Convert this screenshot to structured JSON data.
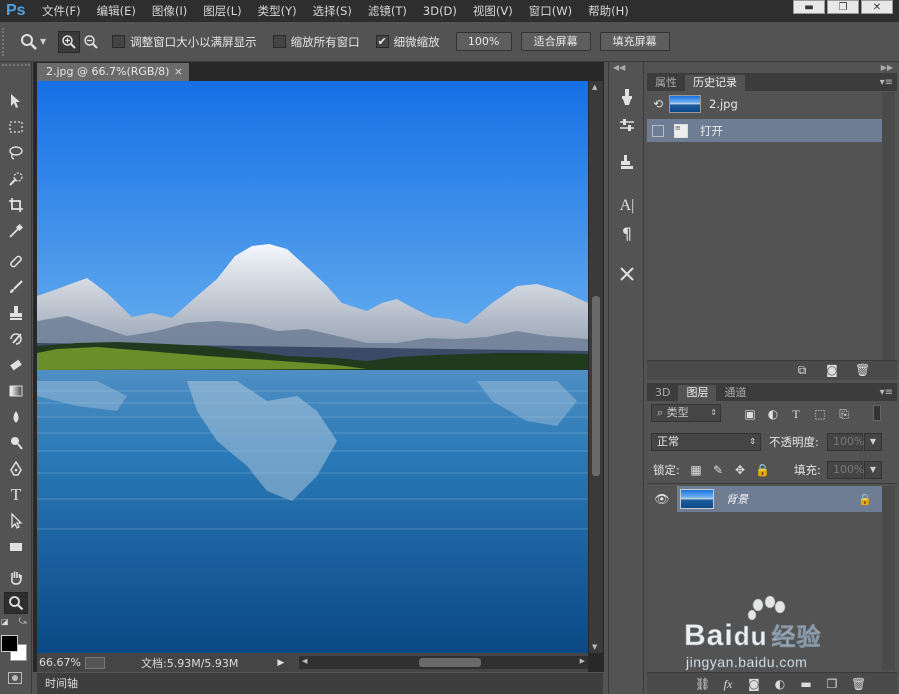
{
  "app": {
    "logo": "Ps"
  },
  "menu": [
    "文件(F)",
    "编辑(E)",
    "图像(I)",
    "图层(L)",
    "类型(Y)",
    "选择(S)",
    "滤镜(T)",
    "3D(D)",
    "视图(V)",
    "窗口(W)",
    "帮助(H)"
  ],
  "window_controls": {
    "minimize": "▬",
    "restore": "❐",
    "close": "✕"
  },
  "options": {
    "resize_windows_label": "调整窗口大小以满屏显示",
    "zoom_all_label": "缩放所有窗口",
    "scrubby_zoom_label": "细微缩放",
    "scrubby_zoom_checked": "✔",
    "zoom_100_label": "100%",
    "fit_screen_label": "适合屏幕",
    "fill_screen_label": "填充屏幕"
  },
  "document": {
    "tab_title": "2.jpg @ 66.7%(RGB/8)",
    "tab_close": "×",
    "zoom": "66.67%",
    "doc_size": "文档:5.93M/5.93M",
    "timeline_label": "时间轴"
  },
  "history_panel": {
    "tabs": [
      "属性",
      "历史记录"
    ],
    "active_tab": 1,
    "snapshot_name": "2.jpg",
    "states": [
      {
        "label": "打开",
        "selected": true
      }
    ]
  },
  "layers_panel": {
    "tabs": [
      "3D",
      "图层",
      "通道"
    ],
    "active_tab": 1,
    "filter_kind": "类型",
    "blend_mode": "正常",
    "opacity_label": "不透明度:",
    "opacity_value": "100%",
    "lock_label": "锁定:",
    "fill_label": "填充:",
    "fill_value": "100%",
    "layers": [
      {
        "name": "背景",
        "visible": true,
        "locked": true
      }
    ]
  },
  "watermark": {
    "brand": "Bai",
    "brand2": "du",
    "suffix": "经验",
    "url": "jingyan.baidu.com"
  },
  "colors": {
    "accent": "#4aa3e8",
    "selection": "#6e7d93",
    "sky_top": "#1d78e0",
    "water": "#0d5a9a"
  }
}
